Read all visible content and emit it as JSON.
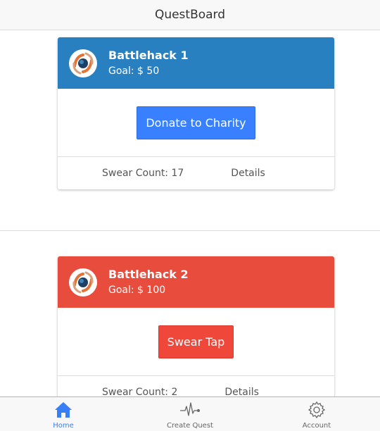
{
  "header": {
    "title": "QuestBoard"
  },
  "quests": [
    {
      "title": "Battlehack 1",
      "goal": "Goal: $ 50",
      "button_label": "Donate to Charity",
      "swear_count": "Swear Count: 17",
      "details_label": "Details",
      "color": "#2980c0"
    },
    {
      "title": "Battlehack 2",
      "goal": "Goal: $ 100",
      "button_label": "Swear Tap",
      "swear_count": "Swear Count: 2",
      "details_label": "Details",
      "color": "#e84c3d"
    }
  ],
  "tabs": [
    {
      "label": "Home",
      "icon": "home-icon",
      "active": true
    },
    {
      "label": "Create Quest",
      "icon": "pulse-icon",
      "active": false
    },
    {
      "label": "Account",
      "icon": "gear-icon",
      "active": false
    }
  ],
  "colors": {
    "accent": "#387ef5",
    "primary_button": "#3880ff",
    "danger_button": "#ef473a"
  }
}
